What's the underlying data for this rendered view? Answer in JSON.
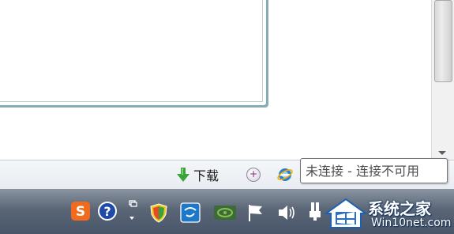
{
  "statusbar": {
    "download_label": "下载",
    "tooltip": "未连接 - 连接不可用"
  },
  "tray": {
    "icons": [
      "sogou-input-icon",
      "help-icon",
      "tray-expand-icon",
      "shield-icon",
      "network-app-icon",
      "nvidia-icon",
      "action-center-flag-icon",
      "volume-icon",
      "network-icon"
    ]
  },
  "watermark": {
    "title": "系统之家",
    "url": "Win10net.com"
  },
  "colors": {
    "accent": "#7bb2b9",
    "taskbar": "#5a6676",
    "download_arrow": "#3aa43a"
  }
}
